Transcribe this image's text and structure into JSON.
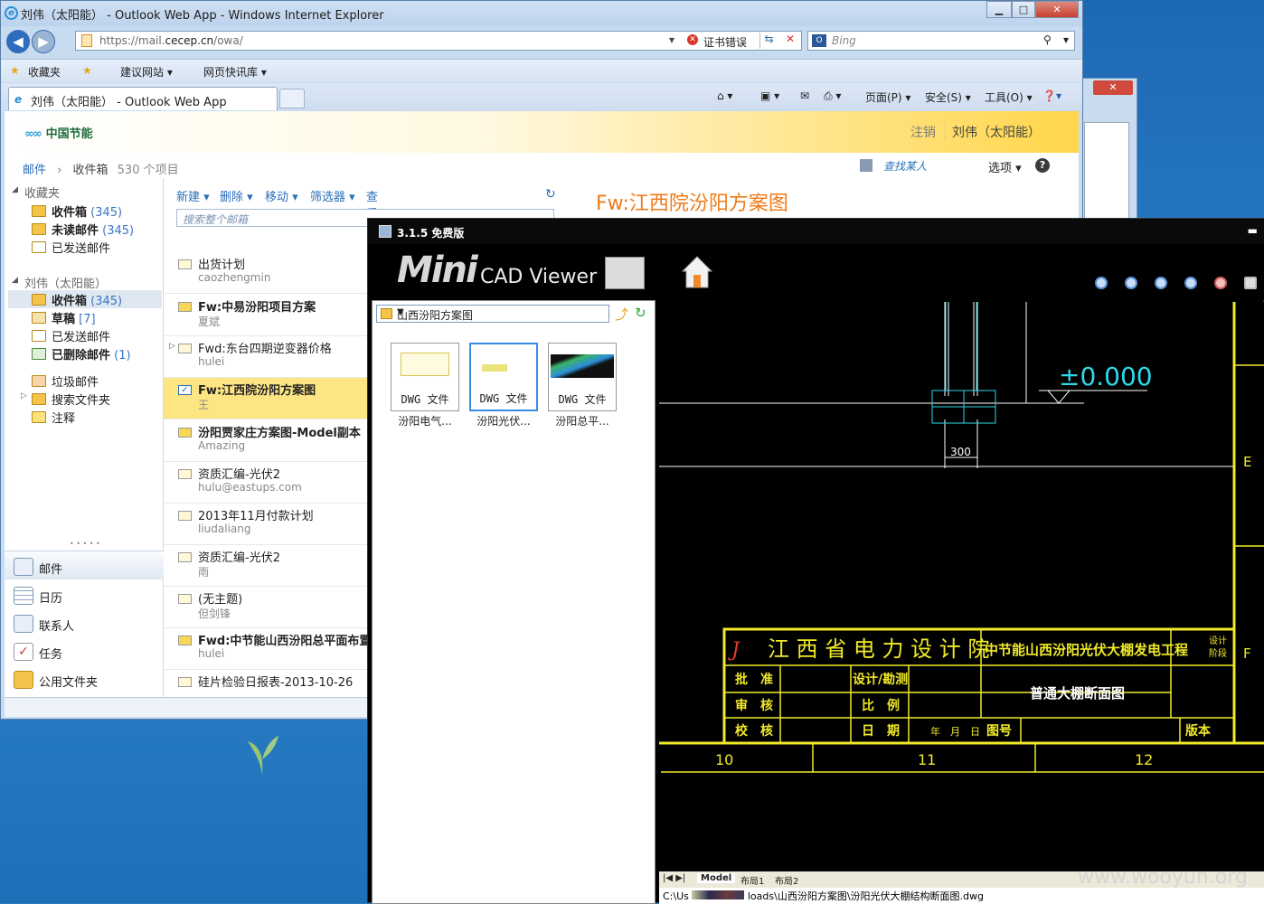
{
  "browser": {
    "window_title": "刘伟（太阳能） - Outlook Web App - Windows Internet Explorer",
    "url_prefix": "https://mail.",
    "url_host": "cecep.cn",
    "url_suffix": "/owa/",
    "cert_error": "证书错误",
    "search_placeholder": "Bing",
    "favorites": [
      "收藏夹",
      "建议网站 ▾",
      "网页快讯库 ▾"
    ],
    "tab_title": "刘伟（太阳能） - Outlook Web App",
    "tools": [
      "页面(P) ▾",
      "安全(S) ▾",
      "工具(O) ▾"
    ],
    "colors": {
      "frame": "#c7dbf1",
      "accent": "#ffd64a",
      "link": "#2a6fb8"
    }
  },
  "owa": {
    "logo_text": "中国节能",
    "sign_out": "注销",
    "user": "刘伟（太阳能）",
    "breadcrumb": {
      "root": "邮件",
      "folder": "收件箱",
      "count": "530 个项目"
    },
    "find_people": "查找某人",
    "options": "选项 ▾",
    "help": "?",
    "favorites_group": "收藏夹",
    "fav_items": [
      {
        "label": "收件箱",
        "count": "(345)"
      },
      {
        "label": "未读邮件",
        "count": "(345)"
      },
      {
        "label": "已发送邮件",
        "count": ""
      }
    ],
    "mailbox_group": "刘伟（太阳能）",
    "mailbox_items": [
      {
        "label": "收件箱",
        "count": "(345)"
      },
      {
        "label": "草稿",
        "count": "[7]"
      },
      {
        "label": "已发送邮件",
        "count": ""
      },
      {
        "label": "已删除邮件",
        "count": "(1)"
      },
      {
        "label": "垃圾邮件",
        "count": ""
      },
      {
        "label": "搜索文件夹",
        "count": ""
      },
      {
        "label": "注释",
        "count": ""
      }
    ],
    "dots": "• • • • •",
    "modules": [
      "邮件",
      "日历",
      "联系人",
      "任务",
      "公用文件夹"
    ],
    "list_toolbar": [
      "新建 ▾",
      "删除 ▾",
      "移动 ▾",
      "筛选器 ▾",
      "查看 ▾"
    ],
    "search_placeholder": "搜索整个邮箱",
    "messages": [
      {
        "subject": "出货计划",
        "from": "caozhengmin"
      },
      {
        "subject": "Fw:中易汾阳项目方案",
        "from": "夏斌"
      },
      {
        "subject": "Fwd:东台四期逆变器价格",
        "from": "hulei"
      },
      {
        "subject": "Fw:江西院汾阳方案图",
        "from": "王"
      },
      {
        "subject": "汾阳贾家庄方案图-Model副本",
        "from": "Amazing"
      },
      {
        "subject": "资质汇编-光伏2",
        "from": "hulu@eastups.com"
      },
      {
        "subject": "2013年11月付款计划",
        "from": "liudaliang"
      },
      {
        "subject": "资质汇编-光伏2",
        "from": "雨"
      },
      {
        "subject": "(无主题)",
        "from": "但剑锋"
      },
      {
        "subject": "Fwd:中节能山西汾阳总平面布置",
        "from": "hulei"
      },
      {
        "subject": "硅片检验日报表-2013-10-26",
        "from": ""
      }
    ],
    "reading_title": "Fw:江西院汾阳方案图"
  },
  "cad": {
    "title": "3.1.5 免费版",
    "brand_mini": "Mini",
    "brand_rest": "CAD Viewer",
    "folder": "山西汾阳方案图",
    "files": [
      {
        "type": "DWG 文件",
        "name": "汾阳电气..."
      },
      {
        "type": "DWG 文件",
        "name": "汾阳光伏..."
      },
      {
        "type": "DWG 文件",
        "name": "汾阳总平..."
      }
    ],
    "drawing": {
      "elevation": "±0.000",
      "dim": "300",
      "grid_right": [
        "E",
        "F"
      ],
      "grid_bottom": [
        "10",
        "11",
        "12"
      ],
      "institute": "江 西 省 电 力 设 计 院",
      "project": "中节能山西汾阳光伏大棚发电工程",
      "stage": "设计\n阶段",
      "rows": [
        "批　准",
        "审　核",
        "校　核"
      ],
      "mid": [
        "设计/勘测",
        "比　例",
        "日　期"
      ],
      "date_fields": "年　月　日",
      "drawing_no": "图号",
      "version": "版本",
      "drawing_name": "普通大棚断面图"
    },
    "layout_tabs": [
      "Model",
      "布局1",
      "布局2"
    ],
    "path_left": "C:\\Us",
    "path_right": "loads\\山西汾阳方案图\\汾阳光伏大棚结构断面图.dwg"
  },
  "watermark": "www.wooyun.org"
}
